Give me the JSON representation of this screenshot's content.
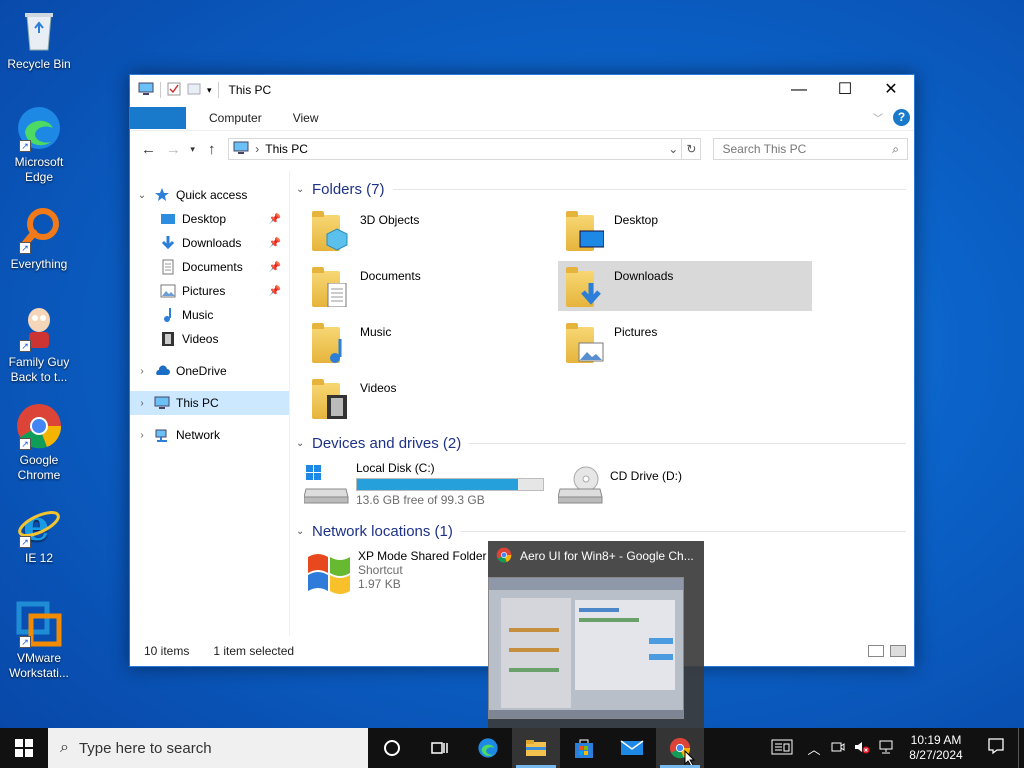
{
  "desktop": {
    "icons": [
      {
        "label": "Recycle Bin",
        "icon": "recycle-bin-icon"
      },
      {
        "label": "Microsoft Edge",
        "icon": "edge-icon"
      },
      {
        "label": "Everything",
        "icon": "everything-search-icon"
      },
      {
        "label": "Family Guy Back to t...",
        "icon": "family-guy-icon"
      },
      {
        "label": "Google Chrome",
        "icon": "chrome-icon"
      },
      {
        "label": "IE 12",
        "icon": "internet-explorer-icon"
      },
      {
        "label": "VMware Workstati...",
        "icon": "vmware-icon"
      }
    ]
  },
  "explorer": {
    "title": "This PC",
    "ribbon_tabs": [
      "Computer",
      "View"
    ],
    "address": "This PC",
    "search_placeholder": "Search This PC",
    "nav": {
      "quick_access": "Quick access",
      "quick_items": [
        "Desktop",
        "Downloads",
        "Documents",
        "Pictures",
        "Music",
        "Videos"
      ],
      "onedrive": "OneDrive",
      "this_pc": "This PC",
      "network": "Network"
    },
    "groups": {
      "folders": "Folders (7)",
      "devices": "Devices and drives (2)",
      "network": "Network locations (1)"
    },
    "folders": [
      "3D Objects",
      "Desktop",
      "Documents",
      "Downloads",
      "Music",
      "Pictures",
      "Videos"
    ],
    "drives": [
      {
        "name": "Local Disk (C:)",
        "free": "13.6 GB free of 99.3 GB",
        "used_fraction": 0.863
      },
      {
        "name": "CD Drive (D:)"
      }
    ],
    "network_location": {
      "name": "XP Mode Shared Folder",
      "type": "Shortcut",
      "size": "1.97 KB"
    },
    "status": {
      "items": "10 items",
      "selected": "1 item selected"
    }
  },
  "preview": {
    "title": "Aero UI for Win8+ - Google Ch..."
  },
  "taskbar": {
    "search_placeholder": "Type here to search",
    "time": "10:19 AM",
    "date": "8/27/2024"
  }
}
